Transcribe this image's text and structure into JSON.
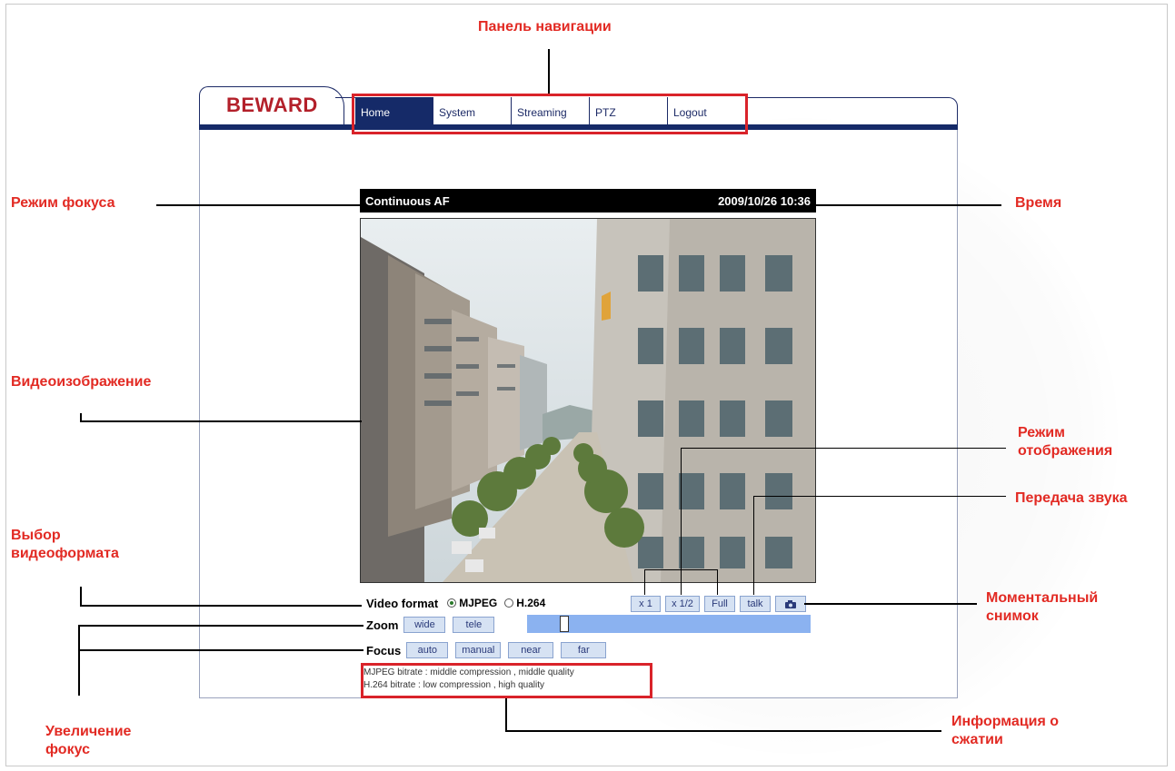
{
  "camera_page": {
    "brand": "BEWARD",
    "nav": [
      "Home",
      "System",
      "Streaming",
      "PTZ",
      "Logout"
    ],
    "video": {
      "focus_mode": "Continuous AF",
      "datetime": "2009/10/26 10:36"
    },
    "video_format": {
      "label": "Video format",
      "options": [
        "MJPEG",
        "H.264"
      ],
      "selected": "MJPEG"
    },
    "view_buttons": [
      "x 1",
      "x 1/2",
      "Full",
      "talk"
    ],
    "snapshot_icon": "camera-icon",
    "zoom": {
      "label": "Zoom",
      "buttons": [
        "wide",
        "tele"
      ],
      "level": 0.12
    },
    "focus": {
      "label": "Focus",
      "buttons": [
        "auto",
        "manual",
        "near",
        "far"
      ]
    },
    "compression": [
      "MJPEG bitrate : middle compression , middle quality",
      "H.264 bitrate : low compression , high quality"
    ]
  },
  "annotations": {
    "nav_panel": "Панель навигации",
    "focus_mode": "Режим фокуса",
    "time": "Время",
    "video_image": "Видеоизображение",
    "display_mode": [
      "Режим",
      "отображения"
    ],
    "audio": "Передача звука",
    "video_format": [
      "Выбор",
      "видеоформата"
    ],
    "snapshot": [
      "Моментальный",
      "снимок"
    ],
    "zoom_focus": [
      "Увеличение",
      "фокус"
    ],
    "compression_info": [
      "Информация о",
      "сжатии"
    ]
  },
  "colors": {
    "annotation": "#e22a23",
    "nav_active": "#152a68",
    "brand": "#b3202a"
  }
}
